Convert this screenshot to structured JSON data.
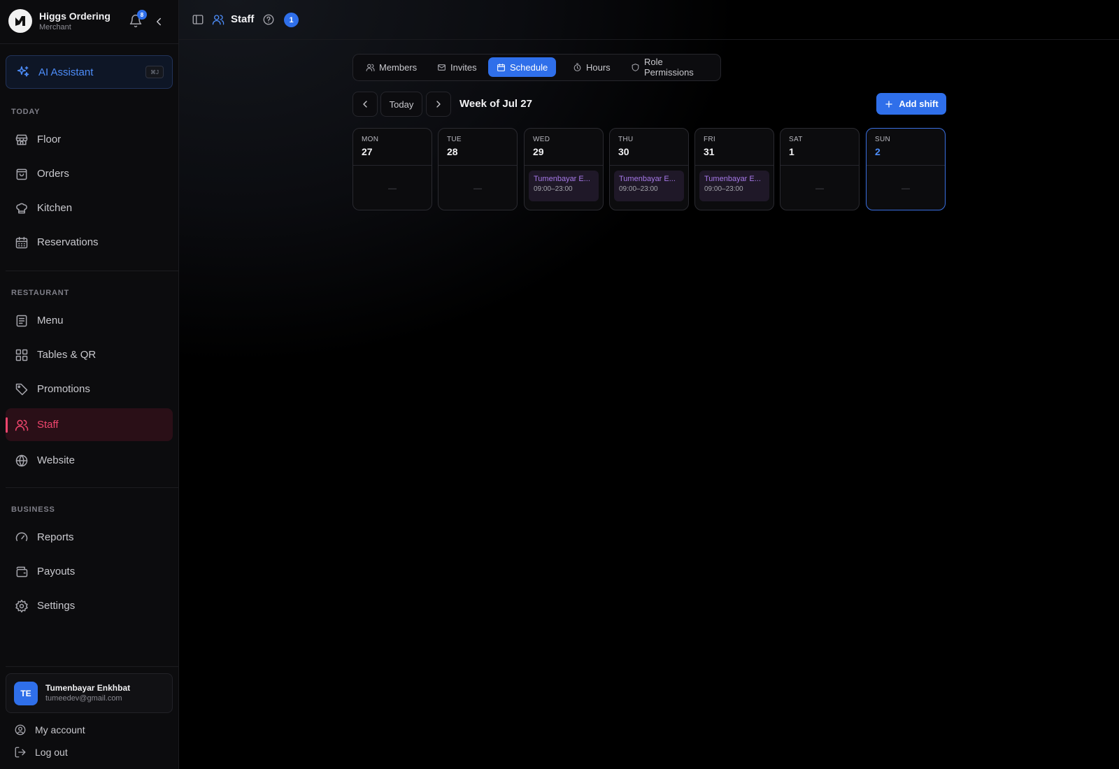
{
  "brand": {
    "name": "Higgs Ordering",
    "subtitle": "Merchant",
    "notification_count": "8"
  },
  "ai_assistant": {
    "label": "AI Assistant",
    "shortcut": "⌘J"
  },
  "sidebar": {
    "sections": {
      "today": "TODAY",
      "restaurant": "RESTAURANT",
      "business": "BUSINESS"
    },
    "items": [
      {
        "label": "Floor",
        "icon": "store-icon"
      },
      {
        "label": "Orders",
        "icon": "shopping-bag-icon"
      },
      {
        "label": "Kitchen",
        "icon": "chef-hat-icon"
      },
      {
        "label": "Reservations",
        "icon": "calendar-icon"
      },
      {
        "label": "Menu",
        "icon": "menu-list-icon"
      },
      {
        "label": "Tables & QR",
        "icon": "grid-icon"
      },
      {
        "label": "Promotions",
        "icon": "tag-icon"
      },
      {
        "label": "Staff",
        "icon": "users-icon",
        "active": true
      },
      {
        "label": "Website",
        "icon": "globe-icon"
      },
      {
        "label": "Reports",
        "icon": "gauge-icon"
      },
      {
        "label": "Payouts",
        "icon": "wallet-icon"
      },
      {
        "label": "Settings",
        "icon": "gear-icon"
      }
    ]
  },
  "user": {
    "initials": "TE",
    "name": "Tumenbayar Enkhbat",
    "email": "tumeedev@gmail.com"
  },
  "footer": {
    "my_account": "My account",
    "log_out": "Log out"
  },
  "header": {
    "title": "Staff",
    "count": "1"
  },
  "tabs": [
    {
      "label": "Members",
      "icon": "users-icon"
    },
    {
      "label": "Invites",
      "icon": "mail-icon"
    },
    {
      "label": "Schedule",
      "icon": "calendar-icon",
      "active": true
    },
    {
      "label": "Hours",
      "icon": "timer-icon"
    },
    {
      "label": "Role Permissions",
      "icon": "shield-icon"
    }
  ],
  "schedule": {
    "today_label": "Today",
    "week_label": "Week of Jul 27",
    "add_shift_label": "Add shift",
    "empty": "—",
    "days": [
      {
        "name": "MON",
        "num": "27",
        "shifts": []
      },
      {
        "name": "TUE",
        "num": "28",
        "shifts": []
      },
      {
        "name": "WED",
        "num": "29",
        "shifts": [
          {
            "name": "Tumenbayar E...",
            "time": "09:00–23:00"
          }
        ]
      },
      {
        "name": "THU",
        "num": "30",
        "shifts": [
          {
            "name": "Tumenbayar E...",
            "time": "09:00–23:00"
          }
        ]
      },
      {
        "name": "FRI",
        "num": "31",
        "shifts": [
          {
            "name": "Tumenbayar E...",
            "time": "09:00–23:00"
          }
        ]
      },
      {
        "name": "SAT",
        "num": "1",
        "shifts": []
      },
      {
        "name": "SUN",
        "num": "2",
        "shifts": [],
        "today": true
      }
    ]
  },
  "colors": {
    "accent": "#2f6fea",
    "active_nav": "#f0466e",
    "shift_text": "#a678e8"
  }
}
